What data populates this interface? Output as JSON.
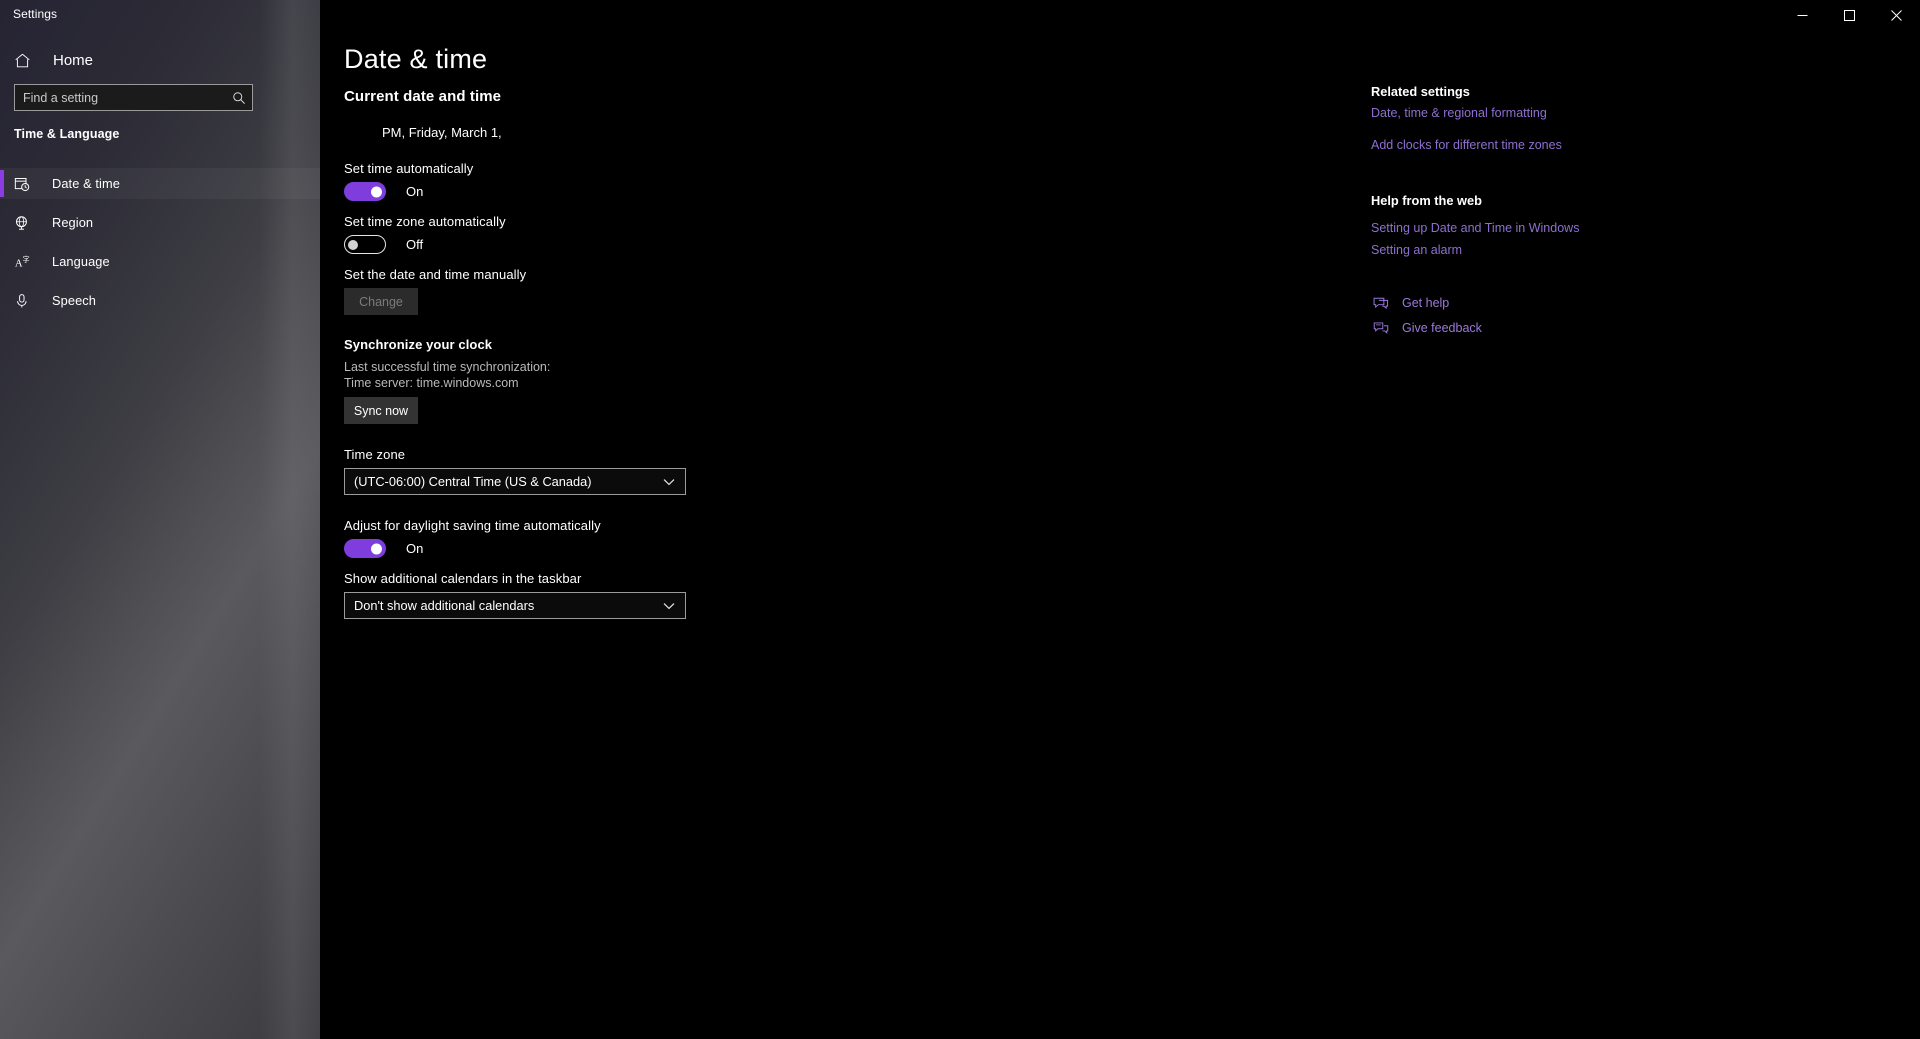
{
  "window": {
    "title": "Settings",
    "minimize_label": "Minimize",
    "maximize_label": "Maximize",
    "close_label": "Close"
  },
  "sidebar": {
    "home_label": "Home",
    "search": {
      "placeholder": "Find a setting",
      "value": ""
    },
    "group_title": "Time & Language",
    "items": [
      {
        "label": "Date & time",
        "icon": "calendar-clock-icon",
        "selected": true
      },
      {
        "label": "Region",
        "icon": "globe-icon",
        "selected": false
      },
      {
        "label": "Language",
        "icon": "language-icon",
        "selected": false
      },
      {
        "label": "Speech",
        "icon": "microphone-icon",
        "selected": false
      }
    ]
  },
  "main": {
    "page_title": "Date & time",
    "current_section_heading": "Current date and time",
    "current_datetime": "PM, Friday, March 1,",
    "set_time_auto": {
      "label": "Set time automatically",
      "state": "On",
      "on": true
    },
    "set_timezone_auto": {
      "label": "Set time zone automatically",
      "state": "Off",
      "on": false
    },
    "set_manually": {
      "label": "Set the date and time manually",
      "button_label": "Change",
      "button_disabled": true
    },
    "synchronize": {
      "heading": "Synchronize your clock",
      "last_sync_line": "Last successful time synchronization:",
      "time_server_line": "Time server: time.windows.com",
      "button_label": "Sync now"
    },
    "time_zone": {
      "label": "Time zone",
      "value": "(UTC-06:00) Central Time (US & Canada)"
    },
    "daylight_saving": {
      "label": "Adjust for daylight saving time automatically",
      "state": "On",
      "on": true
    },
    "additional_calendars": {
      "label": "Show additional calendars in the taskbar",
      "value": "Don't show additional calendars"
    }
  },
  "rail": {
    "related_heading": "Related settings",
    "related_links": [
      "Date, time & regional formatting",
      "Add clocks for different time zones"
    ],
    "help_heading": "Help from the web",
    "help_links": [
      "Setting up Date and Time in Windows",
      "Setting an alarm"
    ],
    "actions": [
      {
        "label": "Get help",
        "icon": "help-chat-icon"
      },
      {
        "label": "Give feedback",
        "icon": "feedback-icon"
      }
    ]
  },
  "colors": {
    "accent": "#7f3ddd",
    "link": "#8e6fd0",
    "selection_bar": "#8c3ce0"
  }
}
